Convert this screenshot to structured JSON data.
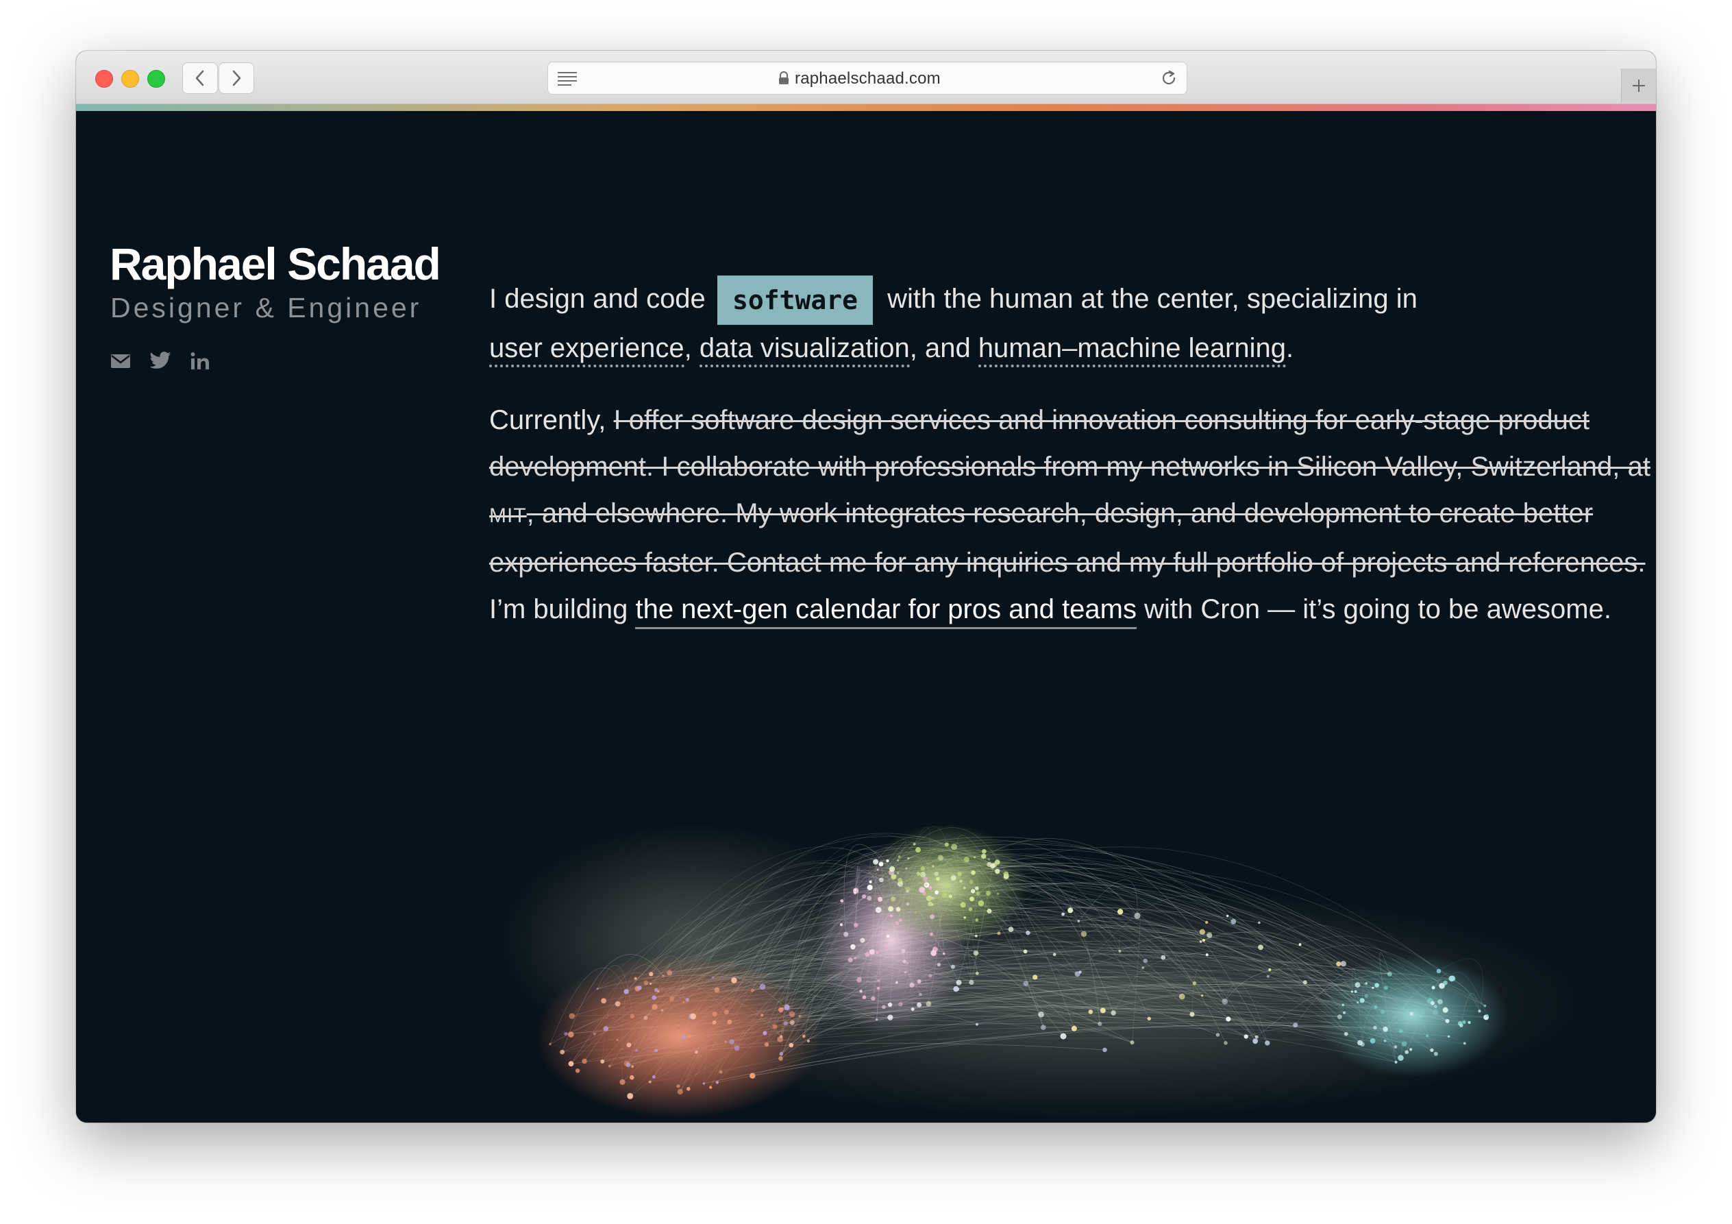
{
  "browser": {
    "url": "raphaelschaad.com"
  },
  "profile": {
    "name": "Raphael Schaad",
    "role": "Designer & Engineer",
    "social": [
      "email-icon",
      "twitter-icon",
      "linkedin-icon"
    ]
  },
  "intro": {
    "lead": "I design and code",
    "tag": "software",
    "rest": "with the human at the center, specializing in",
    "topic1": "user experience",
    "sep1": ",",
    "topic2": "data visualization",
    "sep2": ", and",
    "topic3": "human–machine learning",
    "end": "."
  },
  "bio": {
    "currently": "Currently,",
    "strike1": "I offer software design services and innovation consulting for early-stage product development. I collaborate with professionals from my networks in Silicon Valley, Switzerland, at",
    "mit": "MIT",
    "strike2": ", and elsewhere. My work integrates research, design, and development to create better experiences faster. Contact me for any inquiries and my full portfolio of projects and references.",
    "building": "I’m building",
    "link": "the next-gen calendar for pros and teams",
    "closing": "with Cron — it’s going to be awesome."
  },
  "colors": {
    "background": "#08121a",
    "tag_bg": "#8ab7bd",
    "accent_gradient": [
      "#7fb6b0",
      "#d9a86a",
      "#e0824f",
      "#e07a84",
      "#e58fb3"
    ]
  }
}
